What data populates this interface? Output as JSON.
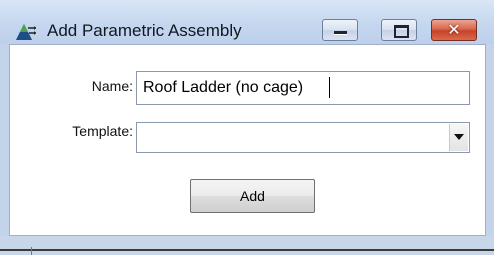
{
  "window": {
    "title": "Add Parametric Assembly",
    "icon": "triangle-arrows-app-icon",
    "controls": {
      "minimize_icon": "minimize-icon",
      "maximize_icon": "maximize-icon",
      "close_icon": "close-icon",
      "close_glyph": "✕"
    }
  },
  "form": {
    "name_label": "Name:",
    "name_value": "Roof Ladder (no cage)",
    "template_label": "Template:",
    "template_value": "",
    "add_label": "Add"
  },
  "colors": {
    "title_bar": "#c5d7ef",
    "close_button": "#c84228",
    "client_background": "#ffffff"
  }
}
